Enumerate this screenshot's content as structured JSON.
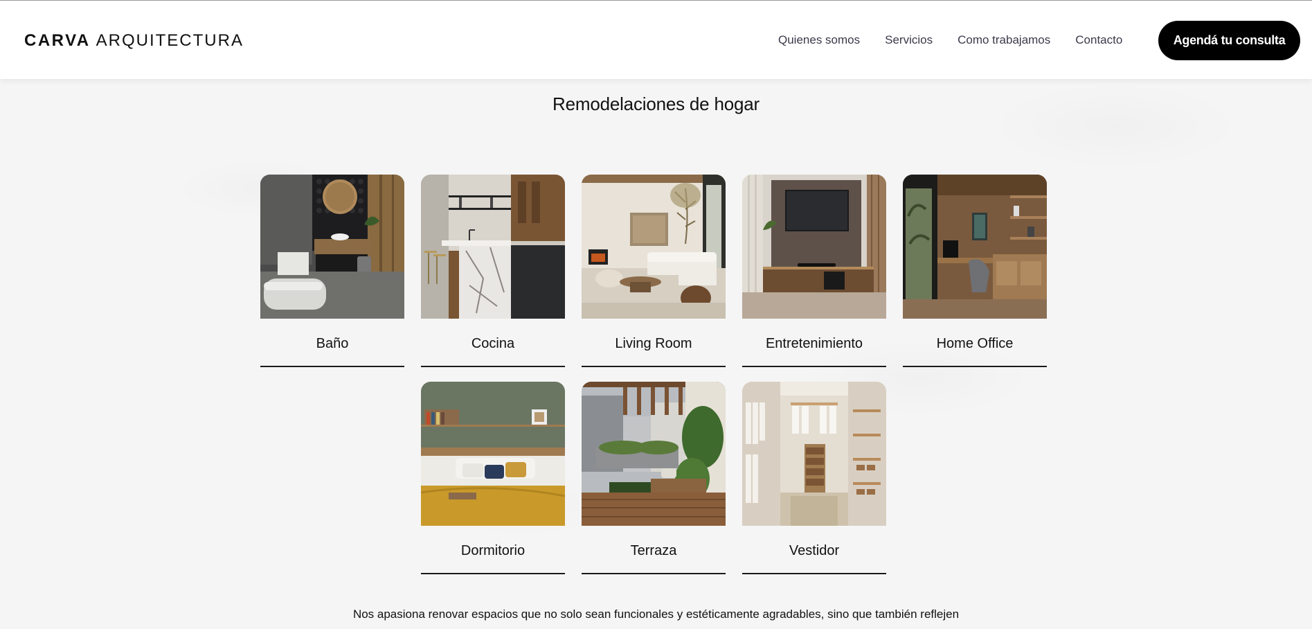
{
  "brand": {
    "bold": "CARVA",
    "light": "ARQUITECTURA"
  },
  "nav": [
    {
      "label": "Quienes somos"
    },
    {
      "label": "Servicios"
    },
    {
      "label": "Como trabajamos"
    },
    {
      "label": "Contacto"
    }
  ],
  "cta_label": "Agendá tu consulta",
  "section_title": "Remodelaciones de hogar",
  "rooms": [
    {
      "label": "Baño"
    },
    {
      "label": "Cocina"
    },
    {
      "label": "Living Room"
    },
    {
      "label": "Entretenimiento"
    },
    {
      "label": "Home Office"
    },
    {
      "label": "Dormitorio"
    },
    {
      "label": "Terraza"
    },
    {
      "label": "Vestidor"
    }
  ],
  "intro_text": "Nos apasiona renovar espacios que no solo sean funcionales y estéticamente agradables, sino que también reflejen"
}
